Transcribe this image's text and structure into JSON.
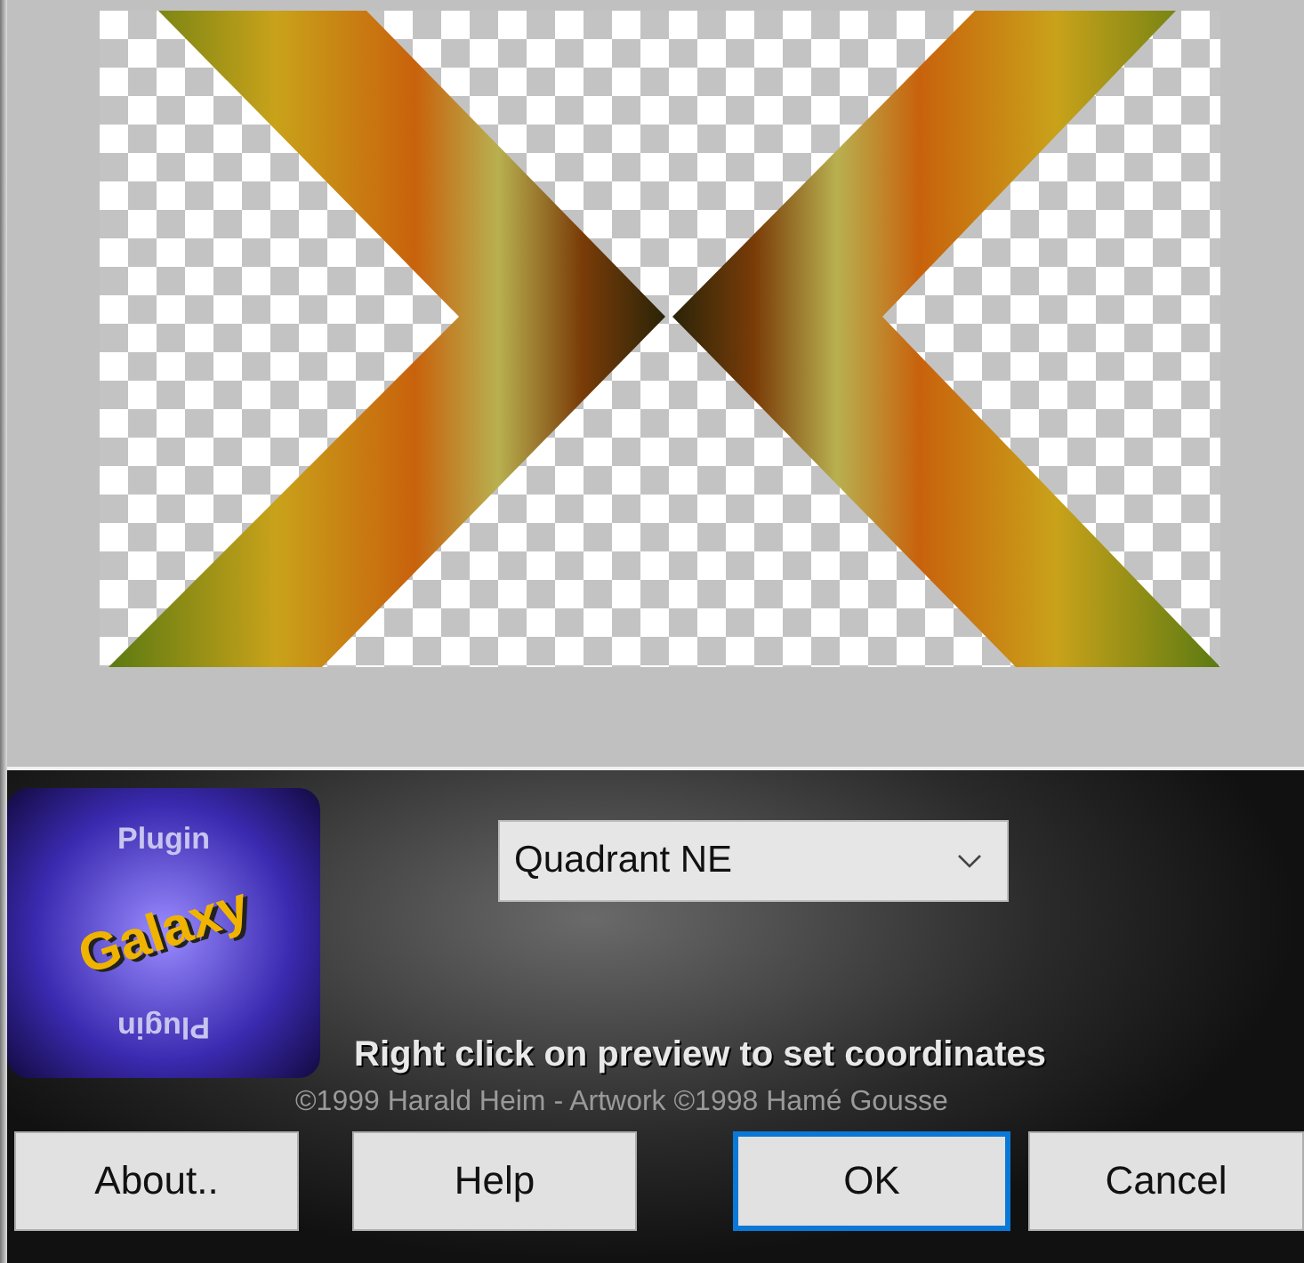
{
  "logo": {
    "texts": [
      "Plugin",
      "Galaxy",
      "Plugin"
    ]
  },
  "mode_dropdown": {
    "value": "Quadrant NE"
  },
  "hint": "Right click on preview to set coordinates",
  "copyright": "©1999 Harald Heim - Artwork ©1998 Hamé Gousse",
  "buttons": [
    {
      "label": "About..",
      "focused": false
    },
    {
      "label": "Help",
      "focused": false
    },
    {
      "label": "OK",
      "focused": true
    },
    {
      "label": "Cancel",
      "focused": false
    }
  ]
}
